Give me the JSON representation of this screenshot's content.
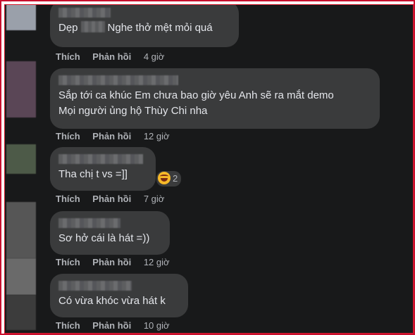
{
  "comments": [
    {
      "text_before": "Dẹp",
      "text_after": "Nghe thở mệt mỏi quá",
      "like": "Thích",
      "reply": "Phản hồi",
      "time": "4 giờ"
    },
    {
      "line1": "Sắp tới ca khúc Em chưa bao giờ yêu Anh sẽ ra mắt demo",
      "line2": "Mọi người ủng hộ Thùy Chi nha",
      "like": "Thích",
      "reply": "Phản hồi",
      "time": "12 giờ"
    },
    {
      "text": "Tha chị t vs =]]",
      "like": "Thích",
      "reply": "Phản hồi",
      "time": "7 giờ",
      "reaction_icon": "haha-emoji-icon",
      "reaction_count": "2"
    },
    {
      "text": "Sơ hở cái là hát =))",
      "like": "Thích",
      "reply": "Phản hồi",
      "time": "12 giờ"
    },
    {
      "text": "Có vừa khóc vừa hát k",
      "like": "Thích",
      "reply": "Phản hồi",
      "time": "10 giờ"
    }
  ],
  "colors": {
    "background": "#18191a",
    "bubble": "#3a3b3c",
    "text": "#e4e6eb",
    "meta": "#b0b3b8",
    "border": "#c8102e"
  }
}
